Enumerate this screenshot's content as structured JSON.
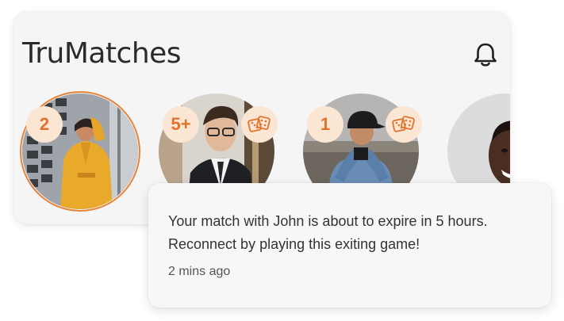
{
  "app": {
    "title": "TruMatches"
  },
  "header": {
    "notifications_icon": "bell-icon"
  },
  "matches": [
    {
      "badge": "2",
      "has_game": false,
      "highlighted": true
    },
    {
      "badge": "5+",
      "has_game": true,
      "highlighted": false
    },
    {
      "badge": "1",
      "has_game": true,
      "highlighted": false
    },
    {
      "badge": "",
      "has_game": false,
      "highlighted": false
    }
  ],
  "notification": {
    "message": "Your match with John is about to expire in 5 hours. Reconnect by playing this exiting game!",
    "time": "2 mins ago"
  },
  "colors": {
    "accent": "#e8833a",
    "badge_bg": "#fbe6d4",
    "badge_text": "#e2732c",
    "card_bg": "#f5f5f5"
  }
}
